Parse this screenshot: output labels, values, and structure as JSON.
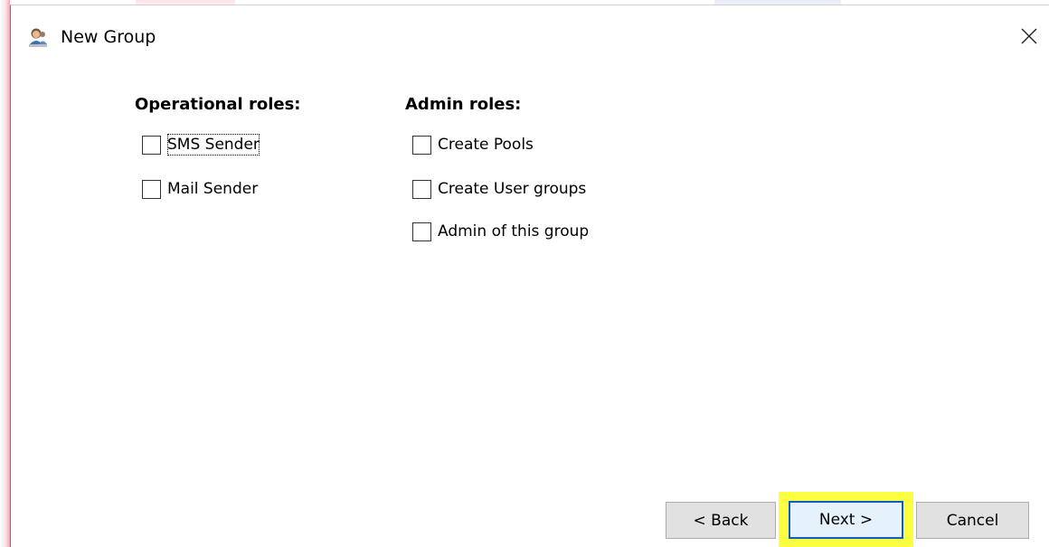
{
  "window": {
    "title": "New Group",
    "icon": "users-group-icon",
    "close_icon": "close-icon"
  },
  "operational": {
    "heading": "Operational roles:",
    "items": [
      {
        "label": "SMS Sender",
        "checked": false,
        "focused": true
      },
      {
        "label": "Mail Sender",
        "checked": false
      }
    ]
  },
  "admin": {
    "heading": "Admin roles:",
    "items": [
      {
        "label": "Create Pools",
        "checked": false
      },
      {
        "label": "Create User groups",
        "checked": false
      },
      {
        "label": "Admin of this group",
        "checked": false
      }
    ]
  },
  "buttons": {
    "back_label": "< Back",
    "next_label": "Next >",
    "cancel_label": "Cancel"
  },
  "colors": {
    "highlight": "#fbff3f",
    "focus_border": "#0b5fc2",
    "button_face": "#e1e1e1",
    "accent_edge": "#f3a8b6"
  }
}
